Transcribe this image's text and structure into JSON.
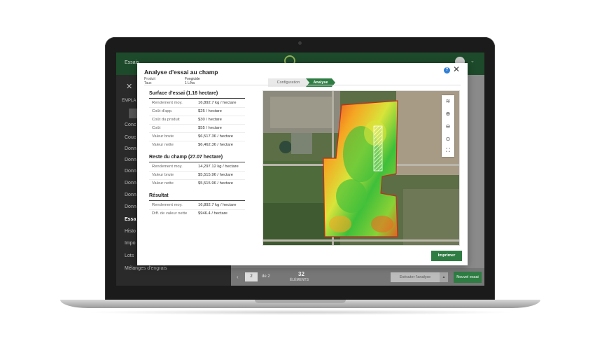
{
  "app": {
    "title": "Essais",
    "sidebar_heading": "EMPLA",
    "sidebar_items": [
      "Conc",
      "Couc",
      "Donn",
      "Donn",
      "Donn",
      "Donn",
      "Donn",
      "Donn",
      "Essa",
      "Histo",
      "Impo",
      "Lots",
      "Mélanges d'engrais"
    ],
    "active_index": 8,
    "pagination": {
      "current": "2",
      "of_label": "de 2"
    },
    "count": {
      "value": "32",
      "label": "ÉLÉMENTS"
    },
    "run_button": "Exécuter l'analyse",
    "new_button": "Nouvel essai"
  },
  "modal": {
    "title": "Analyse d'essai au champ",
    "meta": [
      {
        "label": "Produit",
        "value": "Fongicide"
      },
      {
        "label": "Taux",
        "value": "1 L/ha"
      }
    ],
    "steps": {
      "config": "Configuration",
      "analysis": "Analyse"
    },
    "sections": [
      {
        "title": "Surface d'essai (1.16 hectare)",
        "rows": [
          {
            "label": "Rendement moy.",
            "value": "16,892.7 kg / hectare"
          },
          {
            "label": "Coût d'app.",
            "value": "$25 / hectare"
          },
          {
            "label": "Coût du produit",
            "value": "$30 / hectare"
          },
          {
            "label": "Coût",
            "value": "$55 / hectare"
          },
          {
            "label": "Valeur brute",
            "value": "$6,517.36 / hectare"
          },
          {
            "label": "Valeur nette",
            "value": "$6,462.36 / hectare"
          }
        ]
      },
      {
        "title": "Reste du champ (27.07 hectare)",
        "rows": [
          {
            "label": "Rendement moy.",
            "value": "14,297.12 kg / hectare"
          },
          {
            "label": "Valeur brute",
            "value": "$5,515.96 / hectare"
          },
          {
            "label": "Valeur nette",
            "value": "$5,515.96 / hectare"
          }
        ]
      },
      {
        "title": "Résultat",
        "rows": [
          {
            "label": "Rendement moy.",
            "value": "16,892.7 kg / hectare"
          },
          {
            "label": "Diff. de valeur nette",
            "value": "$946.4 / hectare"
          }
        ]
      }
    ],
    "map_tools": [
      "layers-icon",
      "zoom-in-icon",
      "zoom-out-icon",
      "zoom-reset-icon",
      "fullscreen-icon"
    ],
    "print_button": "Imprimer"
  },
  "colors": {
    "brand_green": "#2e7d43",
    "topbar": "#1d4a2a",
    "help_blue": "#2f7fd6"
  }
}
